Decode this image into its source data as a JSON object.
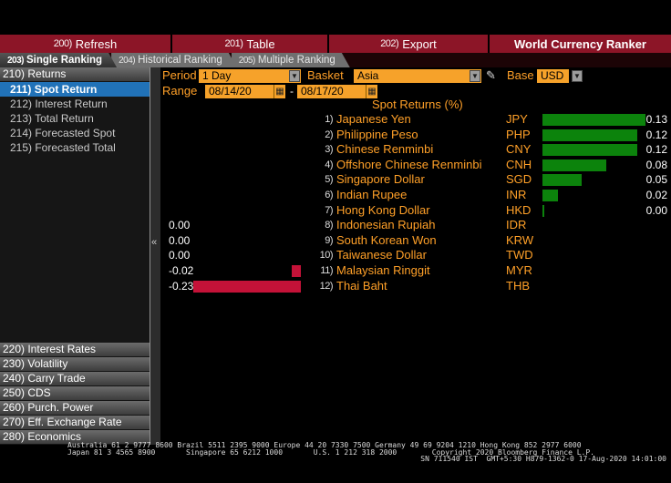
{
  "topbar": {
    "buttons": [
      {
        "key": "200)",
        "label": "Refresh"
      },
      {
        "key": "201)",
        "label": "Table"
      },
      {
        "key": "202)",
        "label": "Export"
      }
    ],
    "title": "World Currency Ranker"
  },
  "tabs": [
    {
      "key": "203)",
      "label": "Single Ranking",
      "active": true
    },
    {
      "key": "204)",
      "label": "Historical Ranking",
      "active": false
    },
    {
      "key": "205)",
      "label": "Multiple Ranking",
      "active": false
    }
  ],
  "sidebar": {
    "returns_header": {
      "key": "210)",
      "label": "Returns"
    },
    "items": [
      {
        "key": "211)",
        "label": "Spot Return",
        "selected": true
      },
      {
        "key": "212)",
        "label": "Interest Return",
        "selected": false
      },
      {
        "key": "213)",
        "label": "Total Return",
        "selected": false
      },
      {
        "key": "214)",
        "label": "Forecasted Spot",
        "selected": false
      },
      {
        "key": "215)",
        "label": "Forecasted Total",
        "selected": false
      }
    ],
    "sections": [
      {
        "key": "220)",
        "label": "Interest Rates"
      },
      {
        "key": "230)",
        "label": "Volatility"
      },
      {
        "key": "240)",
        "label": "Carry Trade"
      },
      {
        "key": "250)",
        "label": "CDS"
      },
      {
        "key": "260)",
        "label": "Purch. Power"
      },
      {
        "key": "270)",
        "label": "Eff. Exchange Rate"
      },
      {
        "key": "280)",
        "label": "Economics"
      }
    ],
    "collapse_icon": "«"
  },
  "controls": {
    "period_label": "Period",
    "period_value": "1 Day",
    "basket_label": "Basket",
    "basket_value": "Asia",
    "base_label": "Base",
    "base_value": "USD",
    "range_label": "Range",
    "range_start": "08/14/20",
    "range_separator": "-",
    "range_end": "08/17/20"
  },
  "chart_data": {
    "type": "bar",
    "title": "Spot Returns (%)",
    "orientation": "horizontal",
    "pos_max": 0.13,
    "neg_max": 0.23,
    "rows": [
      {
        "num": "1)",
        "name": "Japanese Yen",
        "code": "JPY",
        "value": 0.13,
        "display": "0.13",
        "side": "pos"
      },
      {
        "num": "2)",
        "name": "Philippine Peso",
        "code": "PHP",
        "value": 0.12,
        "display": "0.12",
        "side": "pos"
      },
      {
        "num": "3)",
        "name": "Chinese Renminbi",
        "code": "CNY",
        "value": 0.12,
        "display": "0.12",
        "side": "pos"
      },
      {
        "num": "4)",
        "name": "Offshore Chinese Renminbi",
        "code": "CNH",
        "value": 0.08,
        "display": "0.08",
        "side": "pos"
      },
      {
        "num": "5)",
        "name": "Singapore Dollar",
        "code": "SGD",
        "value": 0.05,
        "display": "0.05",
        "side": "pos"
      },
      {
        "num": "6)",
        "name": "Indian Rupee",
        "code": "INR",
        "value": 0.02,
        "display": "0.02",
        "side": "pos"
      },
      {
        "num": "7)",
        "name": "Hong Kong Dollar",
        "code": "HKD",
        "value": 0.0,
        "display": "0.00",
        "side": "pos"
      },
      {
        "num": "8)",
        "name": "Indonesian Rupiah",
        "code": "IDR",
        "value": 0.0,
        "display": "0.00",
        "side": "neg"
      },
      {
        "num": "9)",
        "name": "South Korean Won",
        "code": "KRW",
        "value": 0.0,
        "display": "0.00",
        "side": "neg"
      },
      {
        "num": "10)",
        "name": "Taiwanese Dollar",
        "code": "TWD",
        "value": 0.0,
        "display": "0.00",
        "side": "neg"
      },
      {
        "num": "11)",
        "name": "Malaysian Ringgit",
        "code": "MYR",
        "value": -0.02,
        "display": "-0.02",
        "side": "neg"
      },
      {
        "num": "12)",
        "name": "Thai Baht",
        "code": "THB",
        "value": -0.23,
        "display": "-0.23",
        "side": "neg"
      }
    ]
  },
  "statusbar": {
    "line1": "Australia 61 2 9777 8600 Brazil 5511 2395 9000 Europe 44 20 7330 7500 Germany 49 69 9204 1210 Hong Kong 852 2977 6000",
    "line2": "Japan 81 3 4565 8900       Singapore 65 6212 1000       U.S. 1 212 318 2000        Copyright 2020 Bloomberg Finance L.P.",
    "line3": "SN 711540 IST  GMT+5:30 H879-1362-0 17-Aug-2020 14:01:00"
  },
  "colors": {
    "amber": "#ffa028",
    "amber_fill": "#f6a22a",
    "green_bar": "#0c830c",
    "red_bar": "#c41238",
    "selection_blue": "#2172b8",
    "menubar_red": "#8c1527"
  },
  "icons": {
    "dropdown_arrow": "▼",
    "calendar": "▦",
    "pencil": "✎"
  }
}
